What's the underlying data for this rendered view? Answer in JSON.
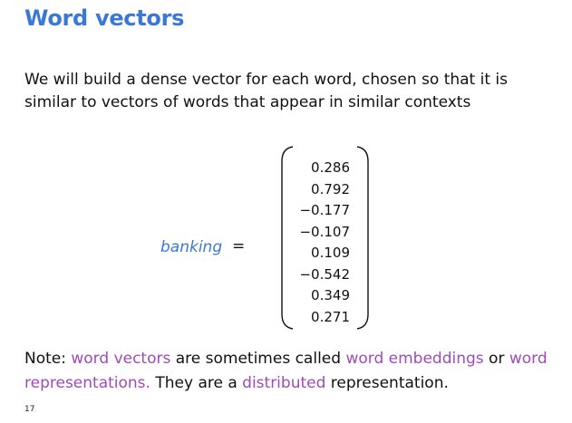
{
  "slide": {
    "title": "Word vectors",
    "body": "We will build a dense vector for each word, chosen so that it is similar to vectors of words that appear in similar contexts",
    "equation": {
      "word": "banking",
      "equals": "=",
      "vector": [
        "0.286",
        "0.792",
        "−0.177",
        "−0.107",
        "0.109",
        "−0.542",
        "0.349",
        "0.271"
      ]
    },
    "note": {
      "prefix": "Note: ",
      "term1": "word vectors",
      "mid1": " are sometimes called ",
      "term2": "word embeddings",
      "mid2": " or ",
      "term3": "word representations.",
      "mid3": " They are a ",
      "term4": "distributed",
      "suffix": " representation."
    },
    "page_number": "17"
  },
  "colors": {
    "title": "#3a78d8",
    "word": "#3a78d8",
    "highlight": "#a04ab8",
    "text": "#111111",
    "background": "#ffffff"
  }
}
